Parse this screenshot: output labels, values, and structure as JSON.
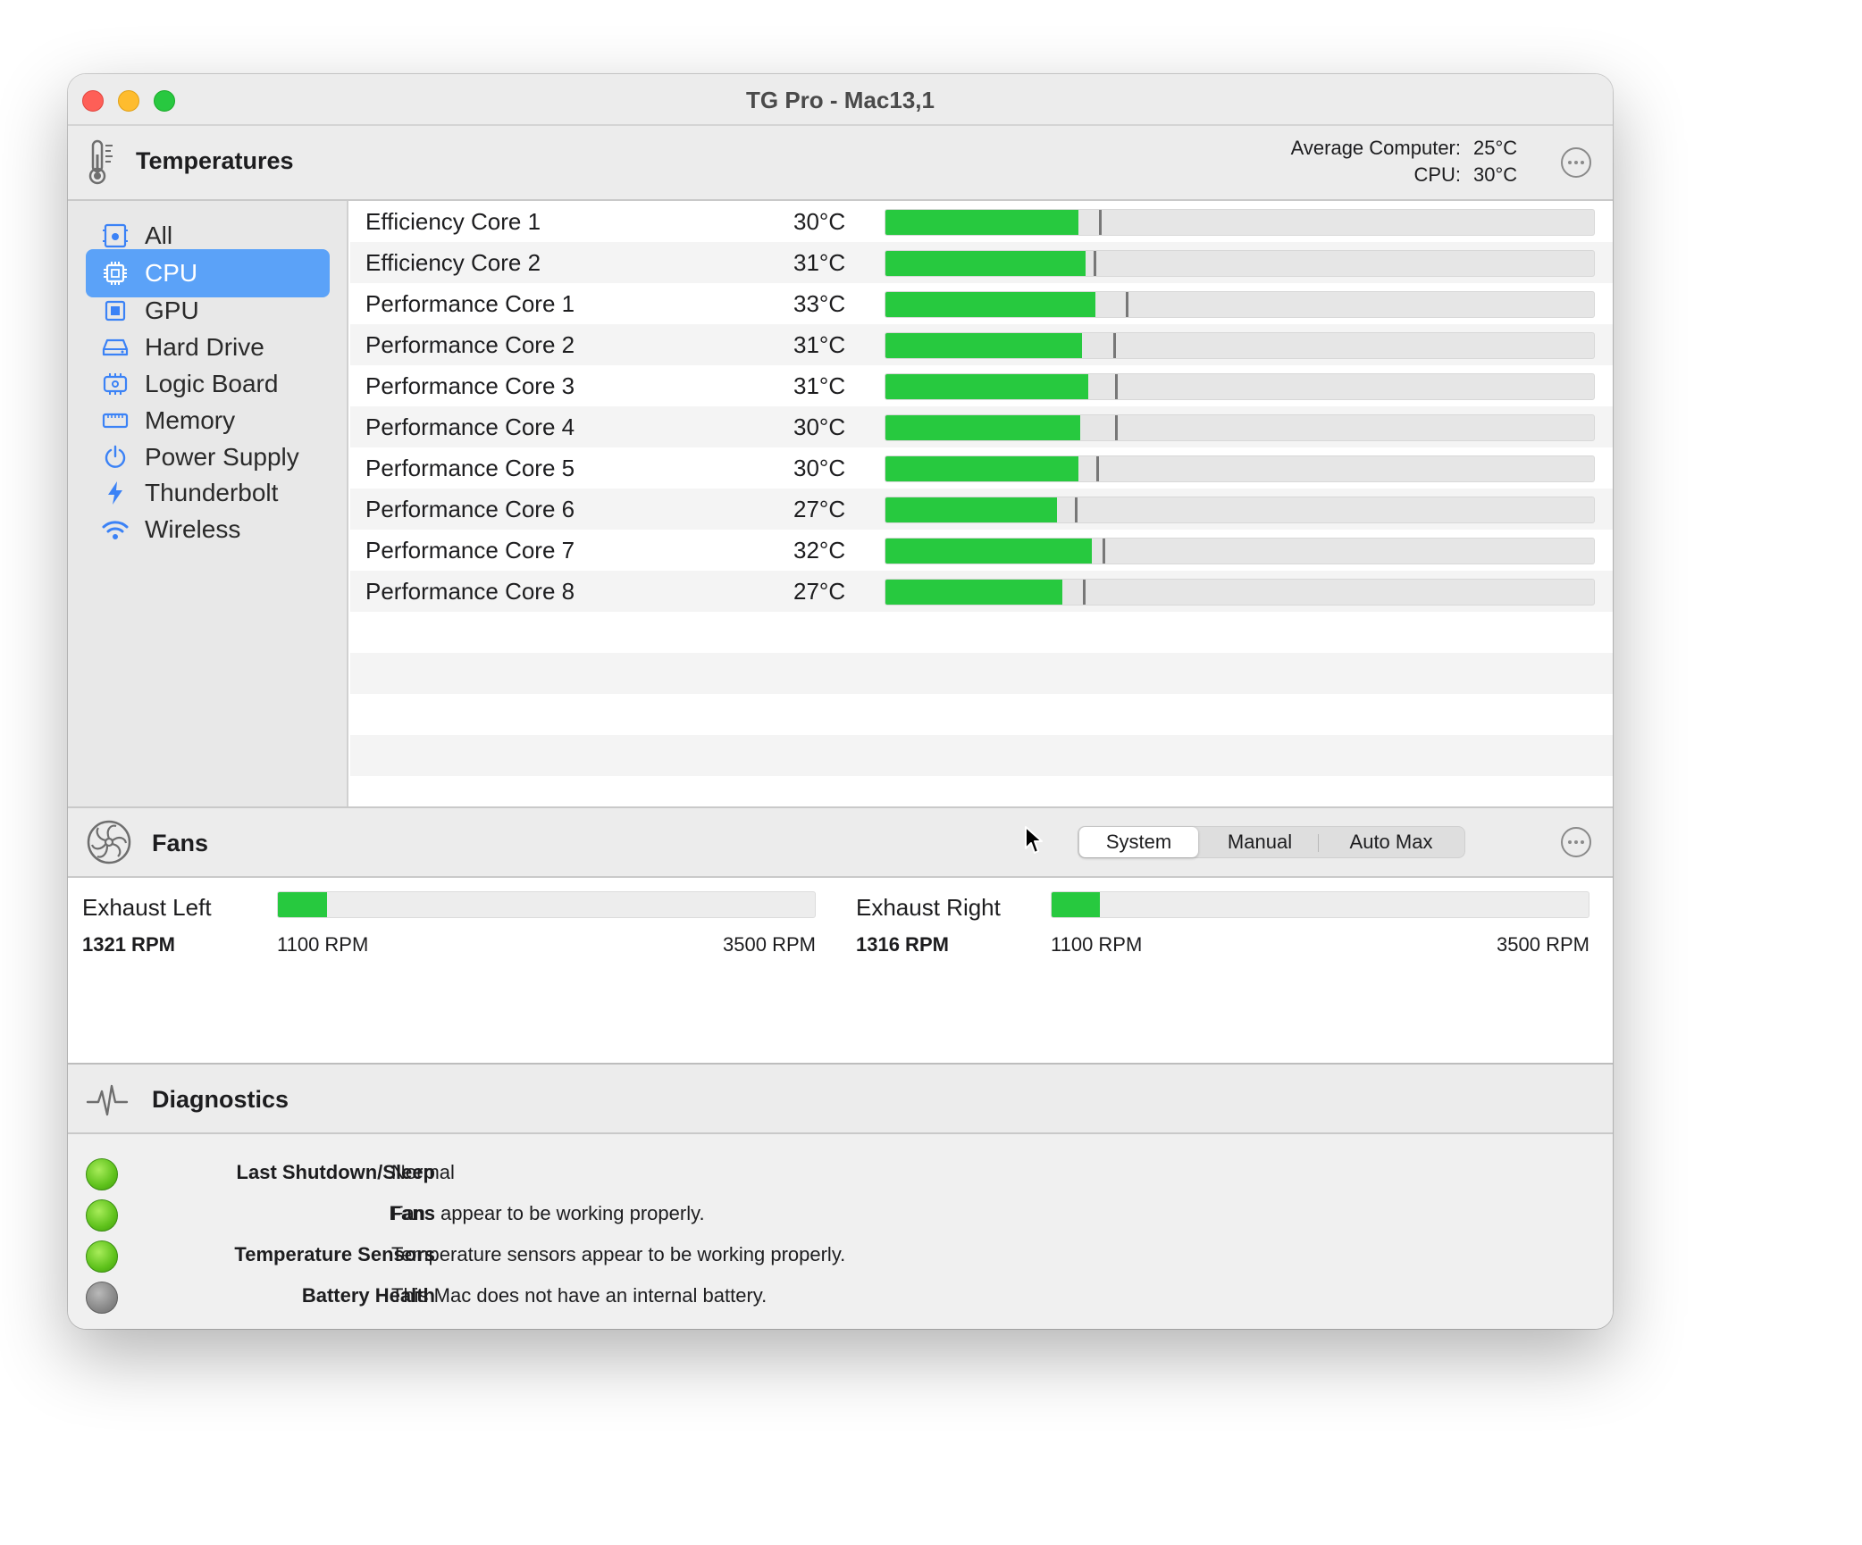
{
  "window": {
    "title": "TG Pro - Mac13,1"
  },
  "temperatures": {
    "title": "Temperatures",
    "average_label": "Average Computer:",
    "average_value": "25°C",
    "cpu_label": "CPU:",
    "cpu_value": "30°C"
  },
  "sidebar": {
    "items": [
      {
        "label": "All",
        "icon": "apple-board-icon"
      },
      {
        "label": "CPU",
        "icon": "cpu-chip-icon",
        "selected": true
      },
      {
        "label": "GPU",
        "icon": "gpu-chip-icon"
      },
      {
        "label": "Hard Drive",
        "icon": "hard-drive-icon"
      },
      {
        "label": "Logic Board",
        "icon": "logic-board-icon"
      },
      {
        "label": "Memory",
        "icon": "memory-icon"
      },
      {
        "label": "Power Supply",
        "icon": "power-icon"
      },
      {
        "label": "Thunderbolt",
        "icon": "thunderbolt-icon"
      },
      {
        "label": "Wireless",
        "icon": "wifi-icon"
      }
    ]
  },
  "sensors": {
    "bar_color": "#27c93f",
    "rows": [
      {
        "name": "Efficiency Core 1",
        "temp": "30°C",
        "level": 0.272,
        "max_level": 0.302
      },
      {
        "name": "Efficiency Core 2",
        "temp": "31°C",
        "level": 0.283,
        "max_level": 0.294
      },
      {
        "name": "Performance Core 1",
        "temp": "33°C",
        "level": 0.296,
        "max_level": 0.339
      },
      {
        "name": "Performance Core 2",
        "temp": "31°C",
        "level": 0.278,
        "max_level": 0.322
      },
      {
        "name": "Performance Core 3",
        "temp": "31°C",
        "level": 0.286,
        "max_level": 0.324
      },
      {
        "name": "Performance Core 4",
        "temp": "30°C",
        "level": 0.275,
        "max_level": 0.324
      },
      {
        "name": "Performance Core 5",
        "temp": "30°C",
        "level": 0.272,
        "max_level": 0.297
      },
      {
        "name": "Performance Core 6",
        "temp": "27°C",
        "level": 0.242,
        "max_level": 0.267
      },
      {
        "name": "Performance Core 7",
        "temp": "32°C",
        "level": 0.291,
        "max_level": 0.307
      },
      {
        "name": "Performance Core 8",
        "temp": "27°C",
        "level": 0.25,
        "max_level": 0.279
      }
    ]
  },
  "fans": {
    "title": "Fans",
    "modes": [
      "System",
      "Manual",
      "Auto Max"
    ],
    "selected_mode": "System",
    "items": [
      {
        "name": "Exhaust Left",
        "rpm": "1321 RPM",
        "min": "1100 RPM",
        "max": "3500 RPM",
        "level": 0.092
      },
      {
        "name": "Exhaust Right",
        "rpm": "1316 RPM",
        "min": "1100 RPM",
        "max": "3500 RPM",
        "level": 0.09
      }
    ]
  },
  "diagnostics": {
    "title": "Diagnostics",
    "items": [
      {
        "label": "Last Shutdown/Sleep",
        "text": "Normal",
        "status": "ok"
      },
      {
        "label": "Fans",
        "text": "Fans appear to be working properly.",
        "status": "ok"
      },
      {
        "label": "Temperature Sensors",
        "text": "Temperature sensors appear to be working properly.",
        "status": "ok"
      },
      {
        "label": "Battery Health",
        "text": "This Mac does not have an internal battery.",
        "status": "na"
      }
    ]
  }
}
